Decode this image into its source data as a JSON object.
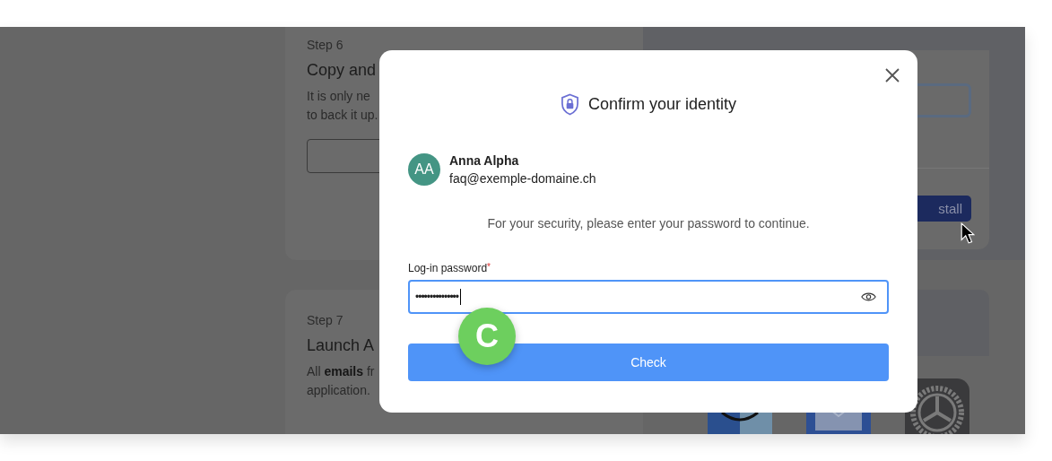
{
  "background": {
    "steps": [
      {
        "kind": "with-field",
        "step": "Step 6",
        "title": "Copy and",
        "lines": [
          "It is only ne",
          "to back it up."
        ]
      },
      {
        "kind": "plain",
        "step": "Step 7",
        "title": "Launch A",
        "lines": [
          "All **emails** fr",
          "application."
        ]
      }
    ],
    "install_button": "stall"
  },
  "dialog": {
    "title": "Confirm your identity",
    "user": {
      "initials": "AA",
      "name": "Anna Alpha",
      "email": "faq@exemple-domaine.ch"
    },
    "message": "For your security, please enter your password to continue.",
    "password": {
      "label": "Log-in password",
      "required_mark": "*",
      "value": "•••••••••••••••"
    },
    "check_button": "Check"
  },
  "step_marker": "C"
}
